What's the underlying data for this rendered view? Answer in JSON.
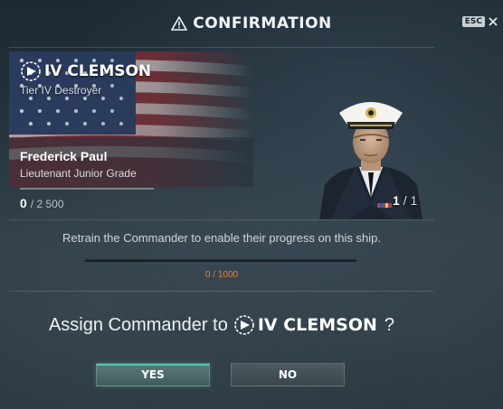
{
  "dialog": {
    "title": "CONFIRMATION",
    "title_icon": "warning-triangle-icon",
    "esc_label": "ESC",
    "close_icon": "close-icon"
  },
  "ship": {
    "name": "IV CLEMSON",
    "type": "Tier IV Destroyer",
    "icon": "destroyer-class-icon",
    "flag": "usa-flag"
  },
  "commander": {
    "name": "Frederick Paul",
    "rank": "Lieutenant Junior Grade",
    "xp_current": "0",
    "xp_max": "/ 2 500",
    "count_current": "1",
    "count_total": "1"
  },
  "retrain": {
    "message": "Retrain the Commander to enable their progress on this ship.",
    "progress_text": "0 / 1000",
    "progress_fraction": 0
  },
  "prompt": {
    "text": "Assign Commander to",
    "ship_name": "IV CLEMSON",
    "question_mark": "?"
  },
  "buttons": {
    "yes": "YES",
    "no": "NO"
  },
  "colors": {
    "accent_teal": "#4ec6b4",
    "progress_orange": "#e7813a"
  }
}
